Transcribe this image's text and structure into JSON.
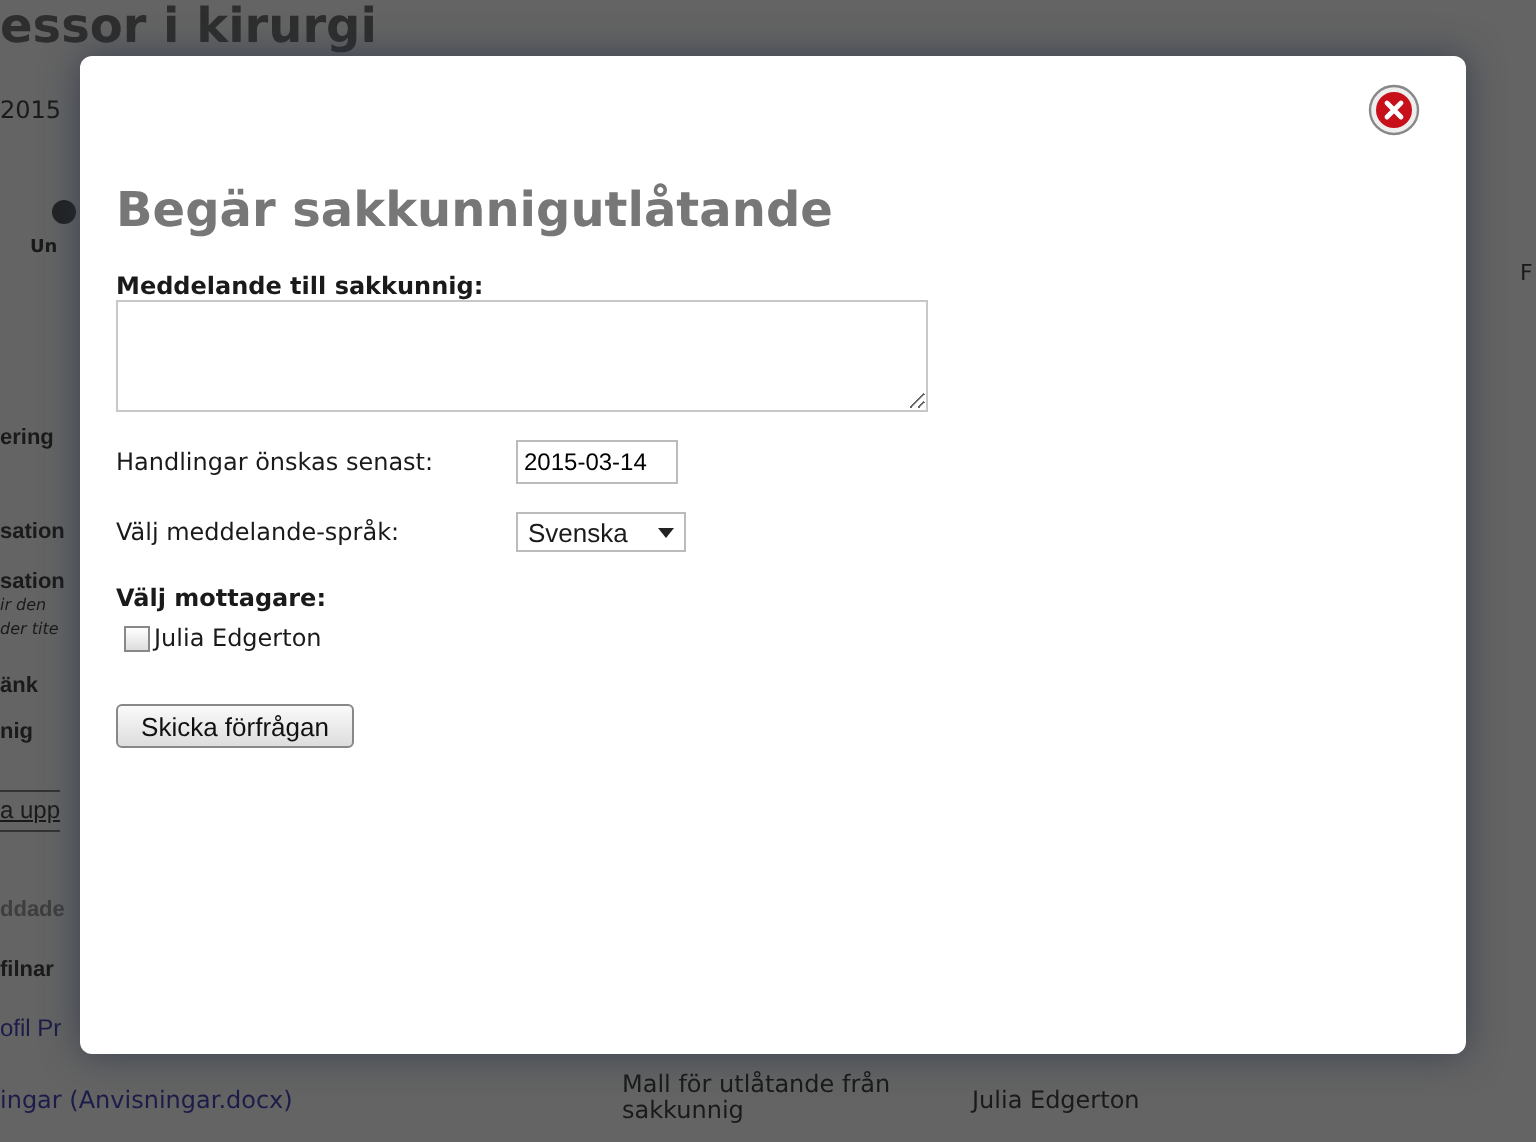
{
  "background_page": {
    "title": "essor i kirurgi",
    "date": "2015",
    "step_label": "Un",
    "left_fragments": [
      {
        "text": "ering",
        "kind": "heading"
      },
      {
        "text": "sation",
        "kind": "heading"
      },
      {
        "text": "sation",
        "kind": "heading"
      },
      {
        "text": "ir den",
        "kind": "note"
      },
      {
        "text": "der tite",
        "kind": "note"
      },
      {
        "text": "änk",
        "kind": "heading"
      },
      {
        "text": "nig",
        "kind": "heading"
      },
      {
        "text": "a upp",
        "kind": "button"
      },
      {
        "text": "ddade",
        "kind": "muted"
      },
      {
        "text": "filnar",
        "kind": "heading"
      },
      {
        "text": "ofil Pr",
        "kind": "link"
      }
    ],
    "right_fragment": "F",
    "table_row": {
      "file_link": "ingar (Anvisningar.docx)",
      "description": "Mall för utlåtande från sakkunnig",
      "person": "Julia Edgerton"
    }
  },
  "dialog": {
    "title": "Begär sakkunnigutlåtande",
    "message_label": "Meddelande till sakkunnig:",
    "deadline_label": "Handlingar önskas senast:",
    "deadline_value": "2015-03-14",
    "language_label": "Välj meddelande-språk:",
    "language_value": "Svenska",
    "recipients_label": "Välj mottagare:",
    "recipients": [
      {
        "name": "Julia Edgerton",
        "checked": false
      }
    ],
    "submit_button": "Skicka förfrågan"
  }
}
